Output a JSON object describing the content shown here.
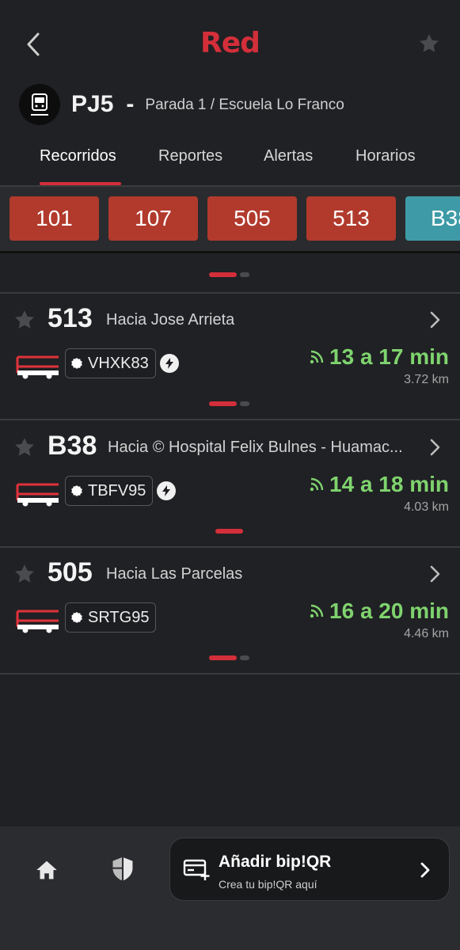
{
  "header": {
    "logo": "Red",
    "back_icon": "chevron-left-icon",
    "favorite_icon": "star-icon"
  },
  "stop": {
    "icon": "bus-stop-icon",
    "code": "PJ5",
    "separator": "-",
    "name": "Parada 1 / Escuela Lo Franco"
  },
  "tabs": [
    {
      "label": "Recorridos",
      "active": true
    },
    {
      "label": "Reportes",
      "active": false
    },
    {
      "label": "Alertas",
      "active": false
    },
    {
      "label": "Horarios",
      "active": false
    }
  ],
  "route_chips": [
    {
      "label": "101",
      "color": "#b13a2d"
    },
    {
      "label": "107",
      "color": "#b13a2d"
    },
    {
      "label": "505",
      "color": "#b13a2d"
    },
    {
      "label": "513",
      "color": "#b13a2d"
    },
    {
      "label": "B38",
      "color": "#3e9aa6"
    }
  ],
  "arrivals": [
    {
      "route": "513",
      "destination": "Hacia Jose Arrieta",
      "plate": "VHXK83",
      "electric": true,
      "eta": "13 a 17 min",
      "distance": "3.72 km"
    },
    {
      "route": "B38",
      "destination": "Hacia © Hospital Felix Bulnes - Huamac...",
      "plate": "TBFV95",
      "electric": true,
      "eta": "14 a 18 min",
      "distance": "4.03 km"
    },
    {
      "route": "505",
      "destination": "Hacia Las Parcelas",
      "plate": "SRTG95",
      "electric": false,
      "eta": "16 a 20 min",
      "distance": "4.46 km"
    }
  ],
  "bottom_bar": {
    "home_icon": "home-icon",
    "shield_icon": "shield-icon",
    "bip_title": "Añadir bip!QR",
    "bip_subtitle": "Crea tu bip!QR aquí"
  },
  "colors": {
    "accent": "#d32f3a",
    "eta": "#7fd36e",
    "background": "#202124"
  }
}
